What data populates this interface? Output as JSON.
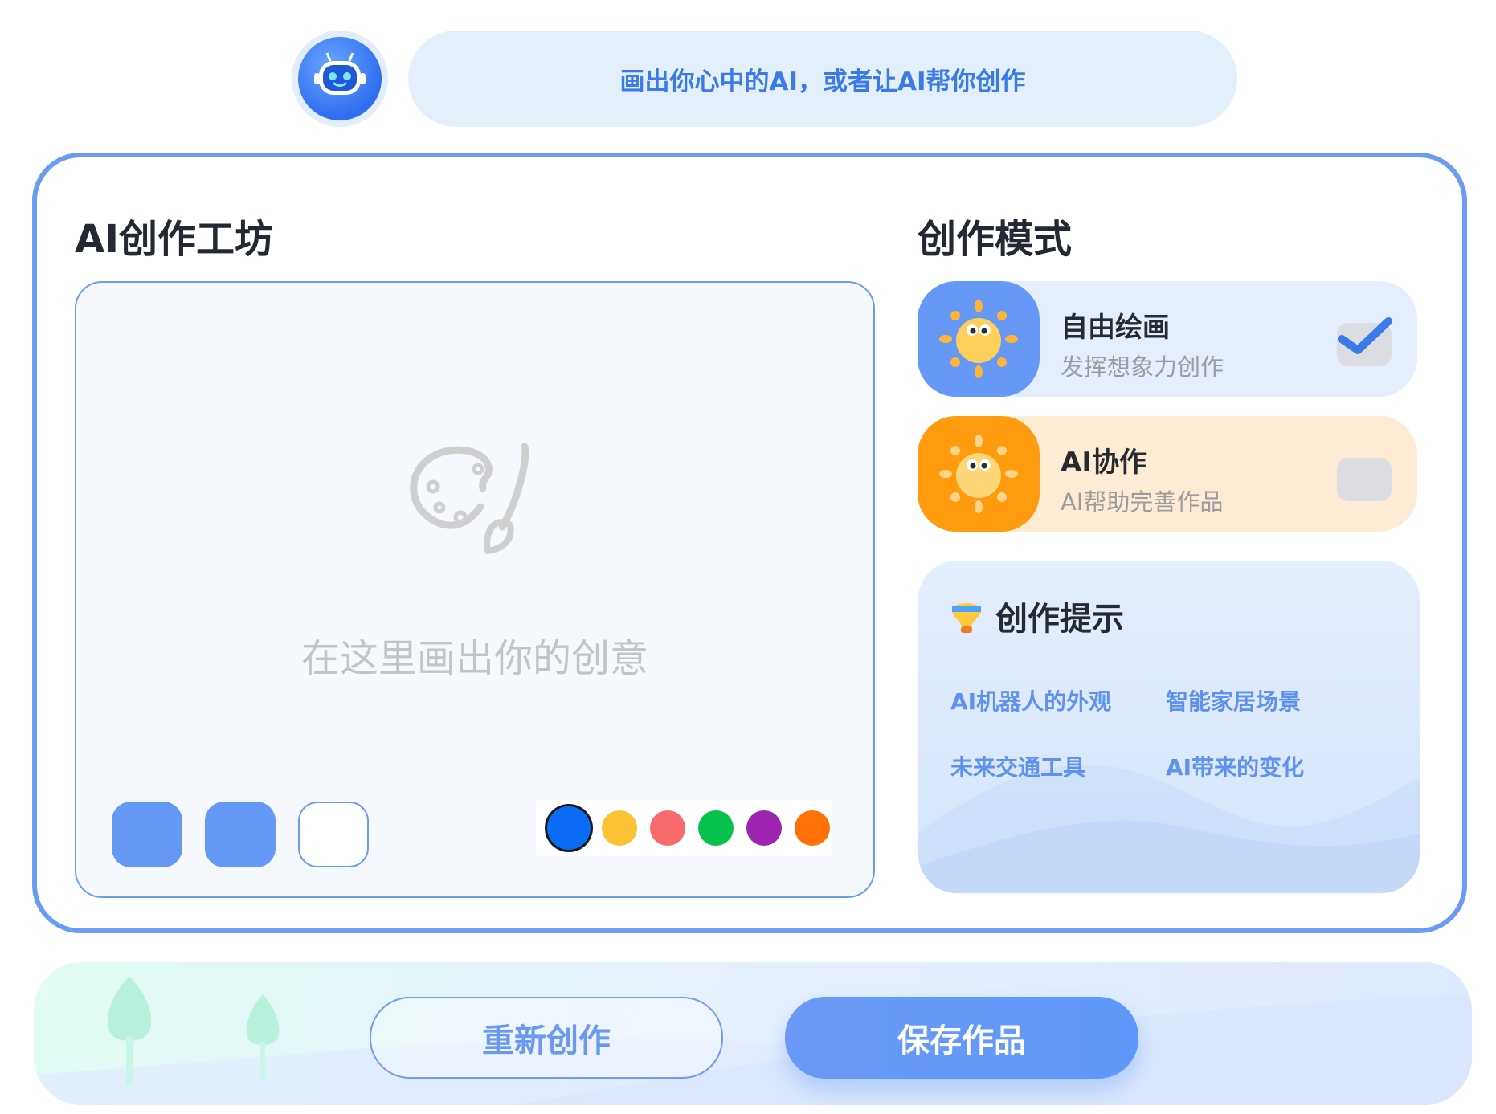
{
  "header": {
    "prompt_text": "画出你心中的AI，或者让AI帮你创作"
  },
  "workshop": {
    "title": "AI创作工坊",
    "canvas_hint": "在这里画出你的创意",
    "palette": [
      "#0b6df6",
      "#fcc234",
      "#f96a6a",
      "#06c24d",
      "#9c26b0",
      "#fc7207"
    ]
  },
  "modes": {
    "title": "创作模式",
    "items": [
      {
        "title": "自由绘画",
        "subtitle": "发挥想象力创作",
        "checked": true
      },
      {
        "title": "AI协作",
        "subtitle": "AI帮助完善作品",
        "checked": false
      }
    ]
  },
  "tips": {
    "title": "创作提示",
    "items": [
      "AI机器人的外观",
      "智能家居场景",
      "未来交通工具",
      "AI带来的变化"
    ]
  },
  "actions": {
    "restart_label": "重新创作",
    "save_label": "保存作品"
  },
  "colors": {
    "accent": "#6b9cf3",
    "mode_free_bg": "#e4eefc",
    "mode_ai_bg": "#fdebd4",
    "mode_ai_icon": "#fe9b0e"
  }
}
